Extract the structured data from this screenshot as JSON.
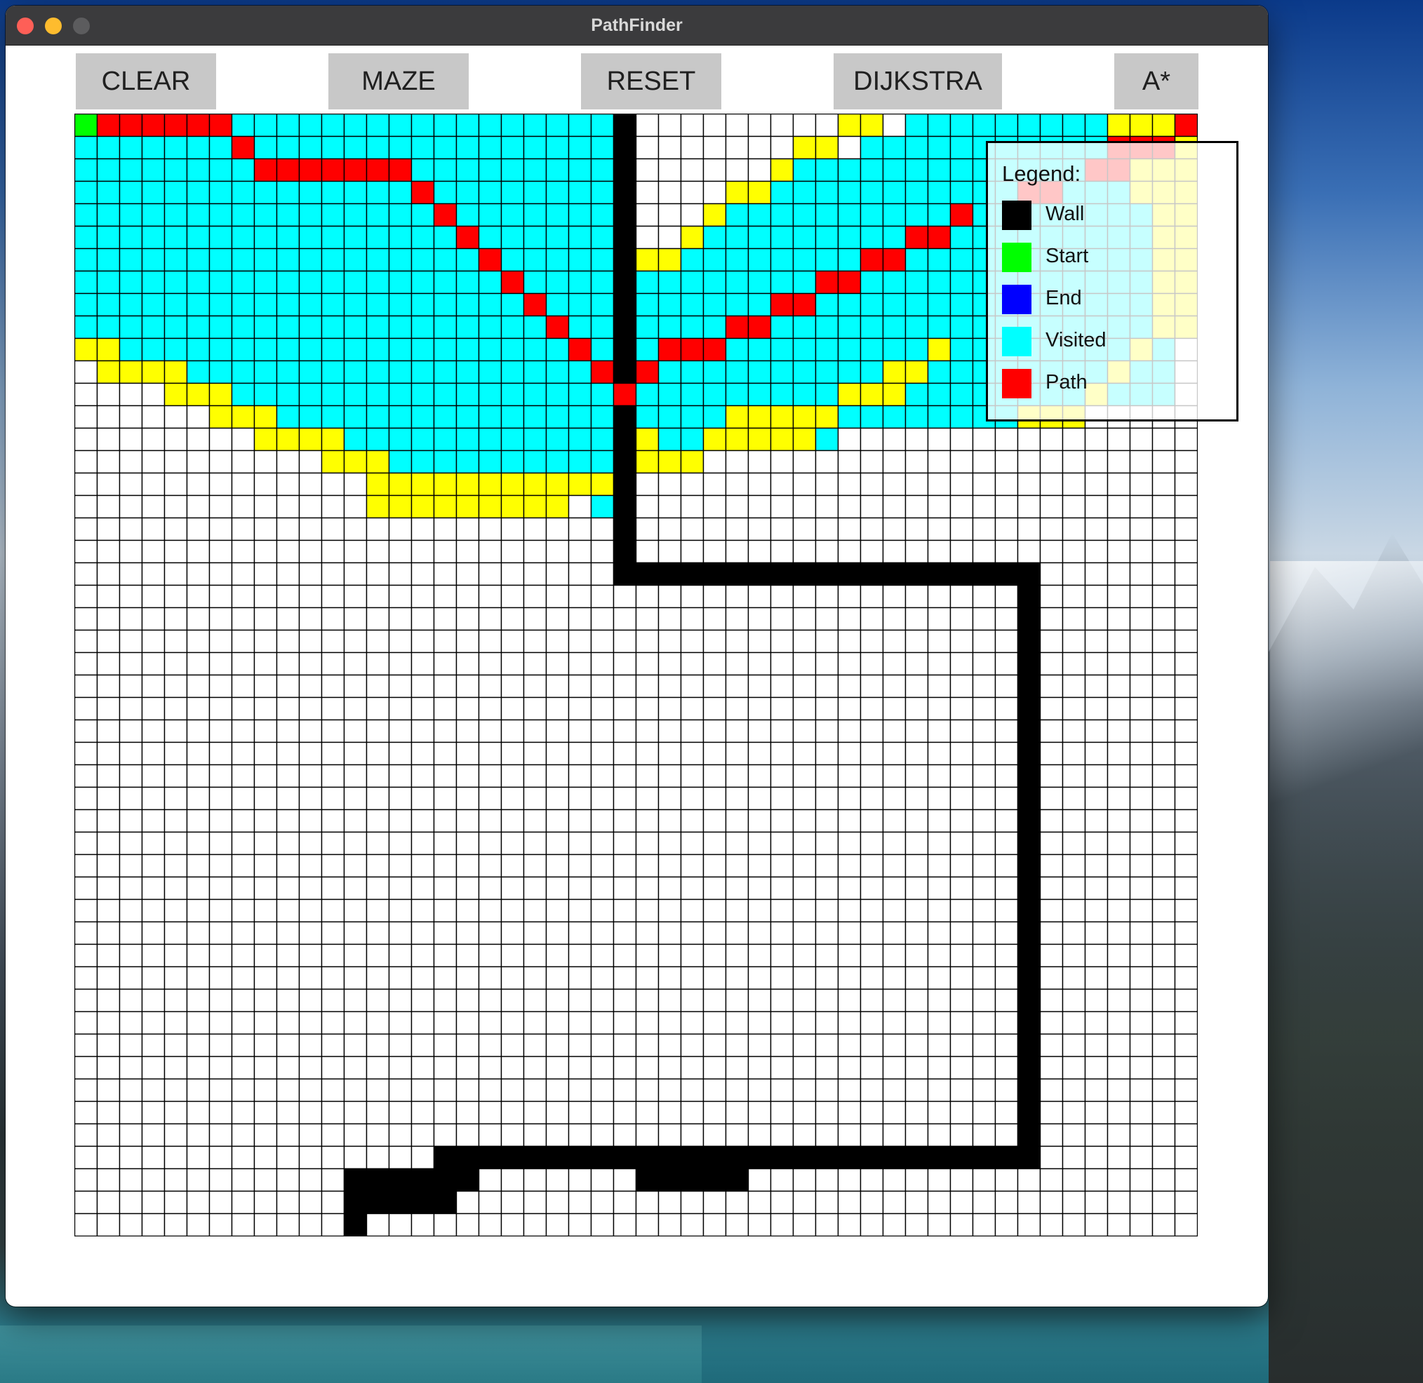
{
  "window": {
    "title": "PathFinder"
  },
  "toolbar": {
    "buttons": [
      {
        "id": "clear",
        "label": "CLEAR"
      },
      {
        "id": "maze",
        "label": "MAZE"
      },
      {
        "id": "reset",
        "label": "RESET"
      },
      {
        "id": "dijkstra",
        "label": "DIJKSTRA"
      },
      {
        "id": "astar",
        "label": "A*"
      }
    ]
  },
  "colors": {
    "wall": "#000000",
    "start": "#00ff00",
    "end": "#0000ff",
    "visited": "#00ffff",
    "path": "#ff0000",
    "frontier": "#ffff00",
    "empty": "#ffffff",
    "gridline": "#000000"
  },
  "legend": {
    "title": "Legend:",
    "items": [
      {
        "label": "Wall",
        "color": "#000000"
      },
      {
        "label": "Start",
        "color": "#00ff00"
      },
      {
        "label": "End",
        "color": "#0000ff"
      },
      {
        "label": "Visited",
        "color": "#00ffff"
      },
      {
        "label": "Path",
        "color": "#ff0000"
      }
    ]
  },
  "grid": {
    "cols": 50,
    "rows": 50,
    "start": [
      0,
      0
    ],
    "walls": [
      {
        "c": 24,
        "r0": 0,
        "r1": 20
      },
      {
        "r": 20,
        "c0": 24,
        "c1": 42
      },
      {
        "c": 42,
        "r0": 20,
        "r1": 46
      },
      {
        "r": 46,
        "c0": 16,
        "c1": 42
      },
      {
        "r": 47,
        "c0": 12,
        "c1": 17
      },
      {
        "r": 47,
        "c0": 25,
        "c1": 29
      },
      {
        "r": 48,
        "c0": 12,
        "c1": 16
      },
      {
        "r": 49,
        "c0": 12,
        "c1": 12
      }
    ],
    "frontier_edges": [
      [
        0,
        50
      ],
      [
        0,
        50
      ],
      [
        0,
        50
      ],
      [
        0,
        50
      ],
      [
        0,
        50
      ],
      [
        0,
        50
      ],
      [
        0,
        50
      ],
      [
        0,
        50
      ],
      [
        0,
        50
      ],
      [
        0,
        50
      ],
      [
        2,
        49
      ],
      [
        5,
        48
      ],
      [
        7,
        47
      ],
      [
        9,
        46
      ],
      [
        11,
        44
      ],
      [
        15,
        42
      ],
      [
        18,
        40
      ],
      [
        23,
        -1
      ]
    ],
    "frontier_right": [
      [
        [
          34,
          36
        ],
        [
          46,
          50
        ]
      ],
      [
        [
          32,
          34
        ],
        [
          46,
          50
        ]
      ],
      [
        [
          31,
          32
        ],
        [
          47,
          50
        ]
      ],
      [
        [
          29,
          31
        ],
        [
          47,
          50
        ]
      ],
      [
        [
          28,
          29
        ],
        [
          48,
          50
        ]
      ],
      [
        [
          27,
          28
        ],
        [
          48,
          50
        ]
      ],
      [
        [
          25,
          27
        ],
        [
          48,
          50
        ]
      ],
      [
        [
          25,
          25
        ],
        [
          48,
          50
        ]
      ],
      [
        [
          48,
          50
        ]
      ],
      [
        [
          48,
          50
        ]
      ],
      [
        [
          38,
          39
        ],
        [
          47,
          48
        ]
      ],
      [
        [
          36,
          38
        ],
        [
          46,
          47
        ]
      ],
      [
        [
          34,
          37
        ],
        [
          45,
          46
        ]
      ],
      [
        [
          29,
          34
        ],
        [
          42,
          45
        ]
      ],
      [
        [
          25,
          26
        ],
        [
          28,
          33
        ]
      ],
      [
        [
          25,
          28
        ]
      ]
    ],
    "path_cells": [
      [
        0,
        1
      ],
      [
        0,
        2
      ],
      [
        0,
        3
      ],
      [
        0,
        4
      ],
      [
        0,
        5
      ],
      [
        0,
        6
      ],
      [
        1,
        7
      ],
      [
        2,
        8
      ],
      [
        2,
        9
      ],
      [
        2,
        10
      ],
      [
        2,
        11
      ],
      [
        2,
        12
      ],
      [
        2,
        13
      ],
      [
        2,
        14
      ],
      [
        3,
        15
      ],
      [
        4,
        16
      ],
      [
        5,
        17
      ],
      [
        6,
        18
      ],
      [
        7,
        19
      ],
      [
        8,
        20
      ],
      [
        9,
        21
      ],
      [
        10,
        22
      ],
      [
        11,
        23
      ],
      [
        12,
        24
      ],
      [
        11,
        25
      ],
      [
        10,
        26
      ],
      [
        10,
        27
      ],
      [
        10,
        28
      ],
      [
        9,
        29
      ],
      [
        9,
        30
      ],
      [
        8,
        31
      ],
      [
        8,
        32
      ],
      [
        7,
        33
      ],
      [
        7,
        34
      ],
      [
        6,
        35
      ],
      [
        6,
        36
      ],
      [
        5,
        37
      ],
      [
        5,
        38
      ],
      [
        4,
        39
      ],
      [
        1,
        46
      ],
      [
        1,
        47
      ],
      [
        1,
        48
      ],
      [
        2,
        45
      ],
      [
        2,
        46
      ],
      [
        3,
        42
      ],
      [
        3,
        43
      ],
      [
        0,
        49
      ]
    ]
  }
}
